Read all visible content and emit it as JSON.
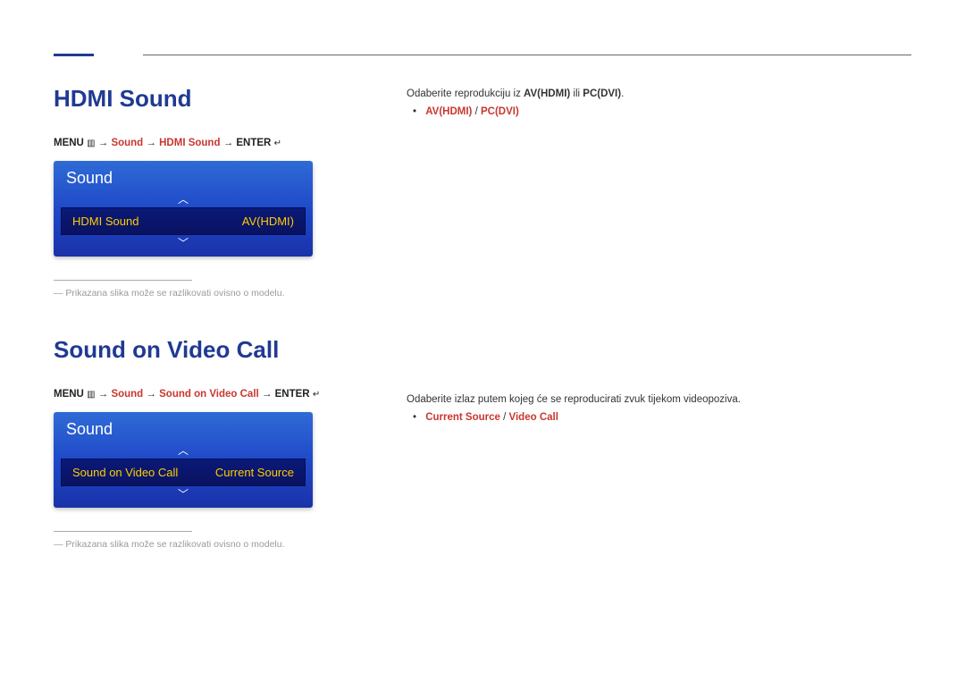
{
  "section1": {
    "title": "HDMI Sound",
    "breadcrumb": {
      "menu": "MENU",
      "menu_icon": "▥",
      "arrow": " → ",
      "p1": "Sound",
      "p2": "HDMI Sound",
      "enter": "ENTER",
      "enter_icon": "↵"
    },
    "osd": {
      "title": "Sound",
      "up": "︿",
      "down": "﹀",
      "row_label": "HDMI Sound",
      "row_value": "AV(HDMI)"
    },
    "footnote": "― Prikazana slika može se razlikovati ovisno o modelu.",
    "right": {
      "line_pre": "Odaberite reprodukciju iz ",
      "opt1": "AV(HDMI)",
      "mid": " ili ",
      "opt2": "PC(DVI)",
      "end": ".",
      "bullet_a": "AV(HDMI)",
      "bullet_sep": " / ",
      "bullet_b": "PC(DVI)"
    }
  },
  "section2": {
    "title": "Sound on Video Call",
    "breadcrumb": {
      "menu": "MENU",
      "menu_icon": "▥",
      "arrow": " → ",
      "p1": "Sound",
      "p2": "Sound on Video Call",
      "enter": "ENTER",
      "enter_icon": "↵"
    },
    "osd": {
      "title": "Sound",
      "up": "︿",
      "down": "﹀",
      "row_label": "Sound on Video Call",
      "row_value": "Current Source"
    },
    "footnote": "― Prikazana slika može se razlikovati ovisno o modelu.",
    "right": {
      "line": "Odaberite izlaz putem kojeg će se reproducirati zvuk tijekom videopoziva.",
      "bullet_a": "Current Source",
      "bullet_sep": " / ",
      "bullet_b": "Video Call"
    }
  }
}
